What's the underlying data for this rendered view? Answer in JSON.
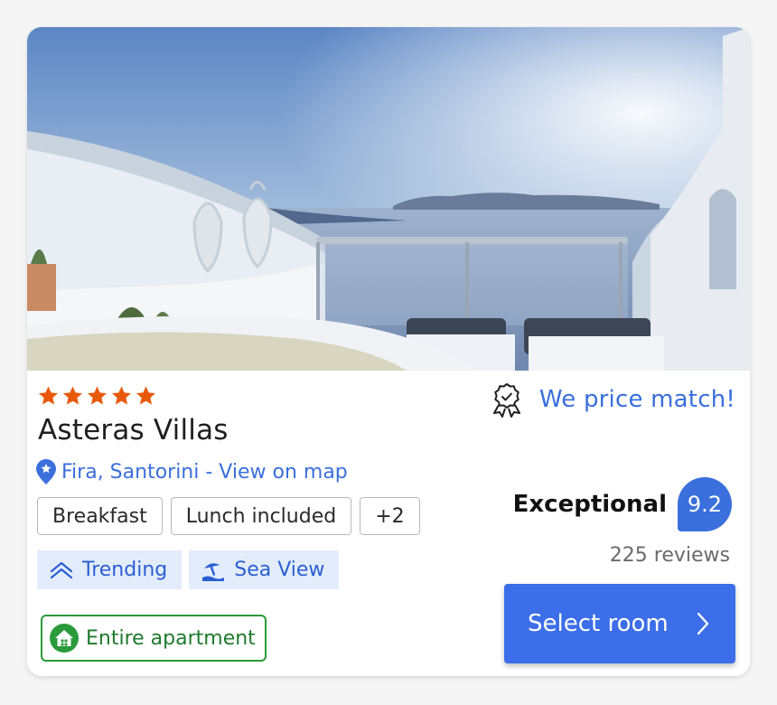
{
  "hotel": {
    "photo_alt": "Terrace overlooking the caldera",
    "stars": 5,
    "name": "Asteras Villas",
    "location_label": "Fira, Santorini - View on map"
  },
  "price_match": {
    "label": "We price match!"
  },
  "amenities": [
    "Breakfast",
    "Lunch included",
    "+2"
  ],
  "tags": [
    {
      "label": "Trending",
      "icon": "trending-up-icon"
    },
    {
      "label": "Sea View",
      "icon": "beach-umbrella-icon"
    }
  ],
  "property_type": {
    "label": "Entire apartment",
    "icon": "house-icon"
  },
  "rating": {
    "word": "Exceptional",
    "score": "9.2",
    "reviews": "225 reviews"
  },
  "cta": {
    "label": "Select room"
  },
  "colors": {
    "accent": "#3b6ee8",
    "star": "#e8590c",
    "green": "#2a9a3a",
    "tag_bg": "#e3ecfb"
  }
}
